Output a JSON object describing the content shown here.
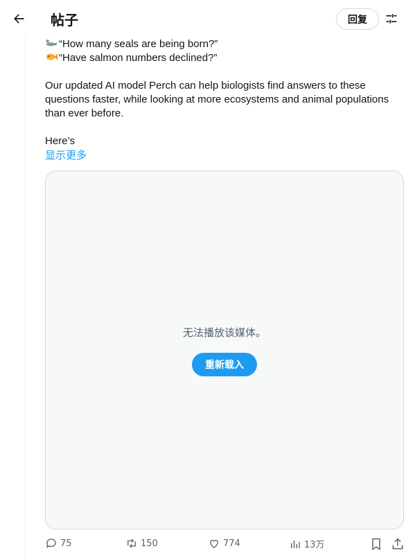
{
  "header": {
    "title": "帖子",
    "reply_label": "回复"
  },
  "post": {
    "line1": "“How many seals are being born?”",
    "line2": "“Have salmon numbers declined?”",
    "paragraph": "Our updated AI model Perch can help biologists find answers to these questions faster, while looking at more ecosystems and animal populations than ever before.",
    "heres": "Here’s",
    "show_more": "显示更多"
  },
  "media": {
    "message": "无法播放该媒体。",
    "reload_label": "重新载入"
  },
  "actions": {
    "replies": "75",
    "reposts": "150",
    "likes": "774",
    "views": "13万"
  },
  "colors": {
    "accent": "#1d9bf0",
    "secondary_text": "#536471",
    "border": "#cfd9de"
  }
}
